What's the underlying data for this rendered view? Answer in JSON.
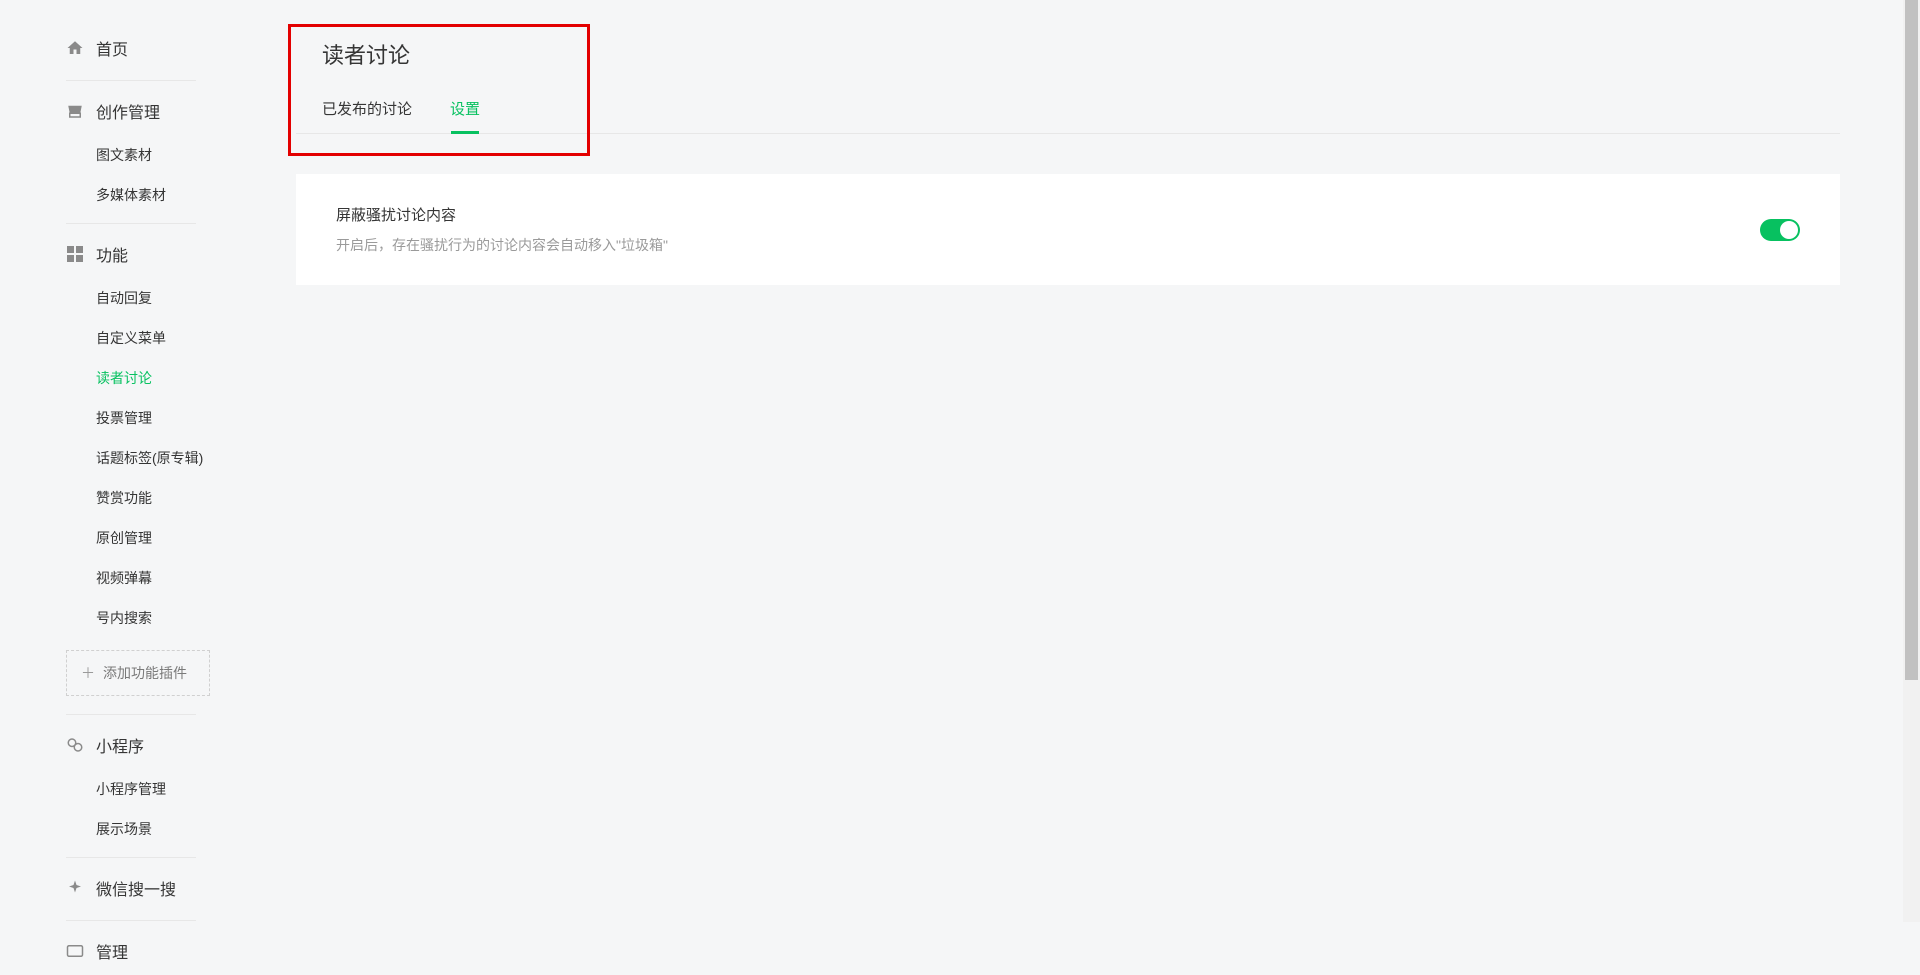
{
  "sidebar": {
    "home": "首页",
    "creation": {
      "label": "创作管理",
      "items": [
        "图文素材",
        "多媒体素材"
      ]
    },
    "features": {
      "label": "功能",
      "items": [
        "自动回复",
        "自定义菜单",
        "读者讨论",
        "投票管理",
        "话题标签(原专辑)",
        "赞赏功能",
        "原创管理",
        "视频弹幕",
        "号内搜索"
      ],
      "addPlugin": "添加功能插件"
    },
    "miniprogram": {
      "label": "小程序",
      "items": [
        "小程序管理",
        "展示场景"
      ]
    },
    "wechatSearch": "微信搜一搜",
    "manage": "管理"
  },
  "main": {
    "title": "读者讨论",
    "tabs": [
      "已发布的讨论",
      "设置"
    ],
    "activeTab": 1,
    "settings": {
      "title": "屏蔽骚扰讨论内容",
      "desc": "开启后，存在骚扰行为的讨论内容会自动移入\"垃圾箱\"",
      "toggleOn": true
    }
  }
}
